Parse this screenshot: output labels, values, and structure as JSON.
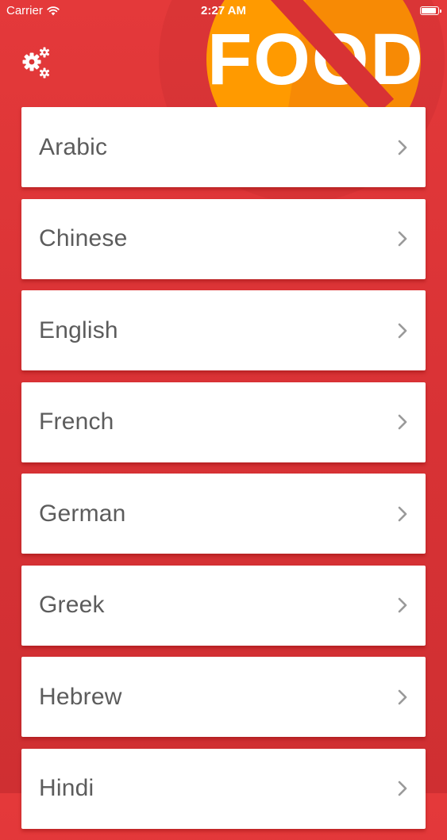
{
  "status_bar": {
    "carrier": "Carrier",
    "time": "2:27 AM",
    "wifi_icon": "wifi-icon",
    "battery_icon": "battery-icon"
  },
  "header": {
    "settings_icon": "gears-icon",
    "logo_text": "FOOD"
  },
  "languages": {
    "items": [
      {
        "label": "Arabic"
      },
      {
        "label": "Chinese"
      },
      {
        "label": "English"
      },
      {
        "label": "French"
      },
      {
        "label": "German"
      },
      {
        "label": "Greek"
      },
      {
        "label": "Hebrew"
      },
      {
        "label": "Hindi"
      }
    ]
  },
  "colors": {
    "background": "#dc3435",
    "logo_circle": "#ff9a00",
    "strike": "#d83234",
    "card": "#ffffff",
    "label": "#5c5c5c",
    "chevron": "#9a9a9a"
  }
}
